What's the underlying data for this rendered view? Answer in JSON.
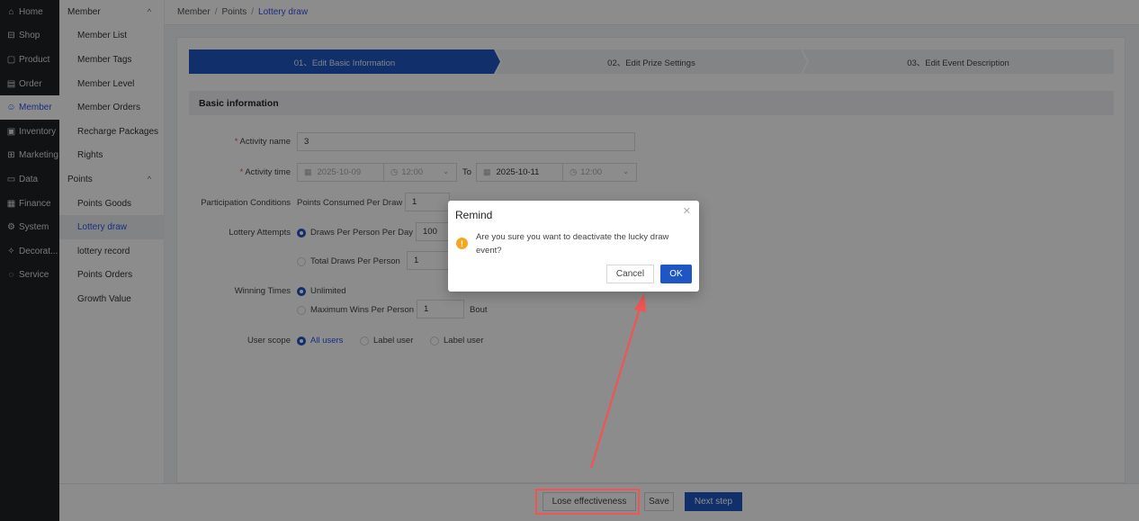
{
  "rail": [
    {
      "icon": "home-icon",
      "glyph": "⌂",
      "label": "Home"
    },
    {
      "icon": "shop-icon",
      "glyph": "⊟",
      "label": "Shop"
    },
    {
      "icon": "product-icon",
      "glyph": "▢",
      "label": "Product"
    },
    {
      "icon": "order-icon",
      "glyph": "▤",
      "label": "Order"
    },
    {
      "icon": "member-icon",
      "glyph": "☺",
      "label": "Member"
    },
    {
      "icon": "inventory-icon",
      "glyph": "▣",
      "label": "Inventory"
    },
    {
      "icon": "marketing-icon",
      "glyph": "⊞",
      "label": "Marketing"
    },
    {
      "icon": "data-icon",
      "glyph": "▭",
      "label": "Data"
    },
    {
      "icon": "finance-icon",
      "glyph": "▦",
      "label": "Finance"
    },
    {
      "icon": "system-icon",
      "glyph": "⚙",
      "label": "System"
    },
    {
      "icon": "decoration-icon",
      "glyph": "✧",
      "label": "Decorat..."
    },
    {
      "icon": "service-icon",
      "glyph": "◌",
      "label": "Service"
    }
  ],
  "submenu": {
    "member_group": "Member",
    "member_items": [
      "Member List",
      "Member Tags",
      "Member Level",
      "Member Orders",
      "Recharge Packages",
      "Rights"
    ],
    "points_group": "Points",
    "points_items": [
      "Points Goods",
      "Lottery draw",
      "lottery record",
      "Points Orders",
      "Growth Value"
    ]
  },
  "breadcrumb": {
    "level1": "Member",
    "level2": "Points",
    "current": "Lottery draw",
    "separator": "/"
  },
  "steps": [
    "01、Edit Basic Information",
    "02、Edit Prize Settings",
    "03、Edit Event Description"
  ],
  "section_title": "Basic information",
  "form": {
    "activity_name_label": "Activity name",
    "activity_name_value": "3",
    "activity_time_label": "Activity time",
    "start_date": "2025-10-09",
    "start_time": "12:00",
    "to_label": "To",
    "end_date": "2025-10-11",
    "end_time": "12:00",
    "participation_label": "Participation Conditions",
    "points_per_draw_label": "Points Consumed Per Draw",
    "points_per_draw_value": "1",
    "lottery_attempts_label": "Lottery Attempts",
    "draws_per_day_label": "Draws Per Person Per Day",
    "draws_per_day_value": "100",
    "total_draws_label": "Total Draws Per Person",
    "total_draws_value": "1",
    "winning_times_label": "Winning Times",
    "unlimited_label": "Unlimited",
    "max_wins_label": "Maximum Wins Per Person",
    "max_wins_value": "1",
    "bout_label": "Bout",
    "user_scope_label": "User scope",
    "all_users_label": "All users",
    "label_user_1": "Label user",
    "label_user_2": "Label user"
  },
  "footer": {
    "lose_label": "Lose effectiveness",
    "save_label": "Save",
    "next_label": "Next step"
  },
  "dialog": {
    "title": "Remind",
    "message": "Are you sure you want to deactivate the lucky draw event?",
    "cancel_label": "Cancel",
    "ok_label": "OK"
  },
  "colors": {
    "primary": "#1e56c4",
    "highlight": "#f05454",
    "warning": "#f5a623"
  }
}
